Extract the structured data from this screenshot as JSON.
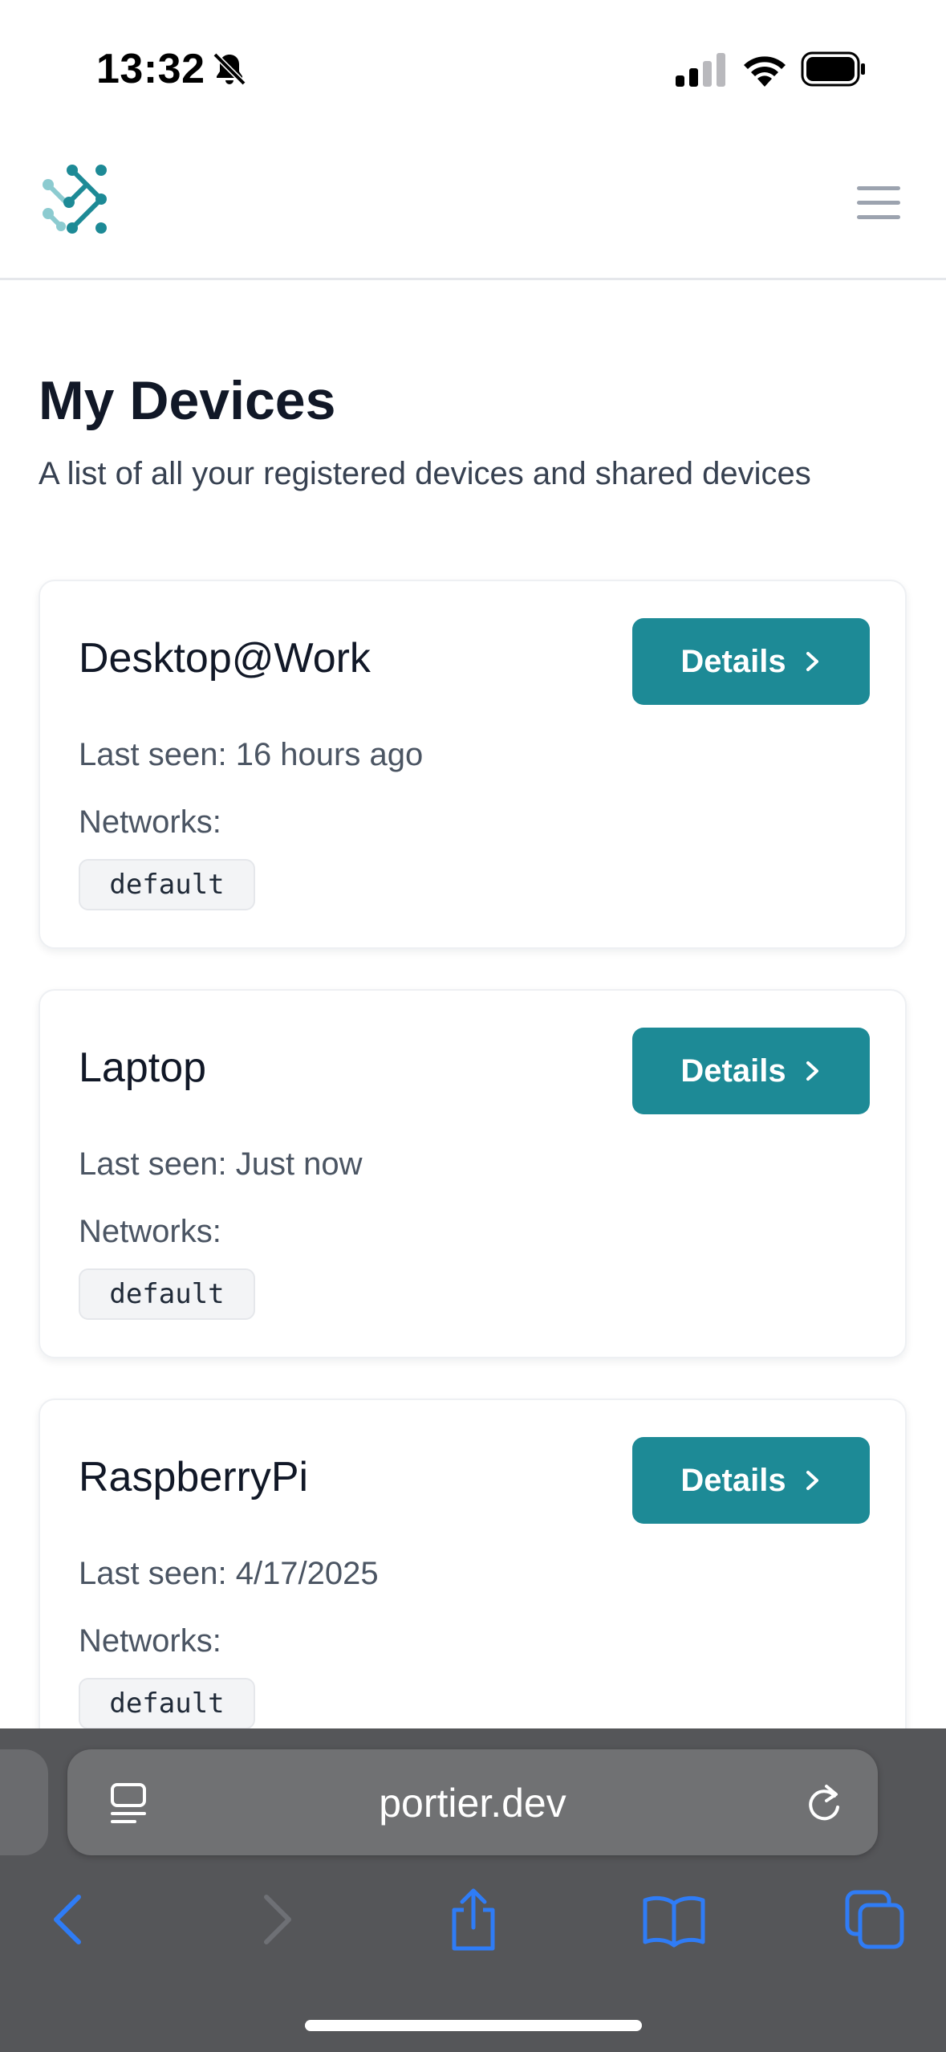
{
  "status_bar": {
    "time": "13:32",
    "icons": [
      "bell-slash-icon",
      "cellular-signal-icon",
      "wifi-icon",
      "battery-icon"
    ]
  },
  "header": {
    "logo": "portier-logo-icon",
    "menu_icon": "hamburger-menu-icon"
  },
  "page": {
    "title": "My Devices",
    "subtitle": "A list of all your registered devices and shared devices"
  },
  "devices": [
    {
      "name": "Desktop@Work",
      "details_label": "Details",
      "last_seen_label": "Last seen:",
      "last_seen_value": "16 hours ago",
      "networks_label": "Networks:",
      "networks": [
        "default"
      ]
    },
    {
      "name": "Laptop",
      "details_label": "Details",
      "last_seen_label": "Last seen:",
      "last_seen_value": "Just now",
      "networks_label": "Networks:",
      "networks": [
        "default"
      ]
    },
    {
      "name": "RaspberryPi",
      "details_label": "Details",
      "last_seen_label": "Last seen:",
      "last_seen_value": "4/17/2025",
      "networks_label": "Networks:",
      "networks": [
        "default"
      ]
    }
  ],
  "browser": {
    "url": "portier.dev",
    "toolbar_icons": [
      "back-icon",
      "forward-icon",
      "share-icon",
      "bookmarks-icon",
      "tabs-icon"
    ]
  },
  "colors": {
    "accent": "#1d8a96",
    "browser_chrome": "#555659",
    "ios_blue": "#2f7cf6"
  }
}
